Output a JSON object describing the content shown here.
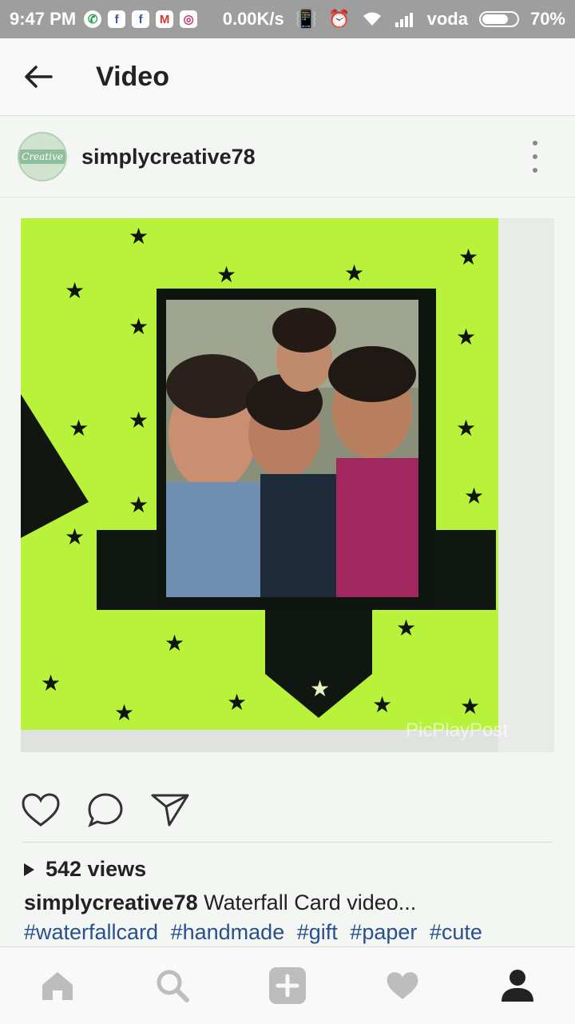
{
  "status_bar": {
    "time": "9:47 PM",
    "net_speed": "0.00K/s",
    "carrier": "voda",
    "battery": "70%",
    "battery_level": 0.7,
    "notification_icons": [
      "whatsapp-icon",
      "facebook-icon",
      "facebook-icon",
      "gmail-icon",
      "instagram-icon"
    ]
  },
  "app_bar": {
    "title": "Video"
  },
  "post": {
    "username": "simplycreative78",
    "avatar_text": "Creative",
    "watermark": "PicPlayPost",
    "views": "542 views",
    "caption": {
      "username": "simplycreative78",
      "text": "Waterfall Card video..."
    },
    "hashtags": [
      "#waterfallcard",
      "#handmade",
      "#gift",
      "#paper",
      "#cute"
    ]
  },
  "colors": {
    "status_bar": "#9e9e9e",
    "card_green": "#b8f23a",
    "hashtag_blue": "#27508f",
    "nav_icon_inactive": "#bdbdbd",
    "nav_icon_active": "#222222"
  },
  "bottom_nav": [
    {
      "icon": "home-icon"
    },
    {
      "icon": "search-icon"
    },
    {
      "icon": "add-icon"
    },
    {
      "icon": "heart-icon"
    },
    {
      "icon": "profile-icon"
    }
  ]
}
